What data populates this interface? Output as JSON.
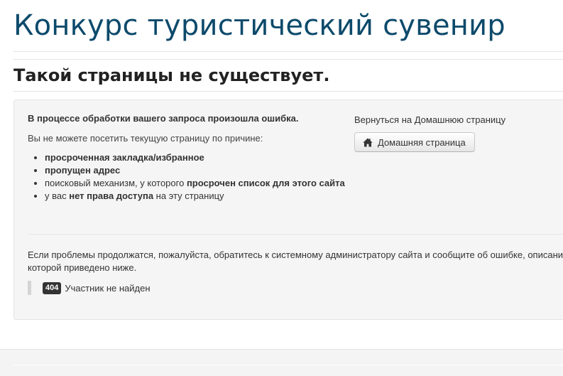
{
  "site": {
    "title": "Конкурс туристический сувенир"
  },
  "page": {
    "heading": "Такой страницы не существует."
  },
  "error": {
    "lead": "В процессе обработки вашего запроса произошла ошибка.",
    "reason_intro": "Вы не можете посетить текущую страницу по причине:",
    "reasons": [
      {
        "parts": [
          {
            "text": "просроченная закладка/избранное",
            "bold": true
          }
        ]
      },
      {
        "parts": [
          {
            "text": "пропущен адрес",
            "bold": true
          }
        ]
      },
      {
        "parts": [
          {
            "text": "поисковый механизм, у которого ",
            "bold": false
          },
          {
            "text": "просрочен список для этого сайта",
            "bold": true
          }
        ]
      },
      {
        "parts": [
          {
            "text": "у вас ",
            "bold": false
          },
          {
            "text": "нет права доступа",
            "bold": true
          },
          {
            "text": " на эту страницу",
            "bold": false
          }
        ]
      }
    ],
    "home_prompt": "Вернуться на Домашнюю страницу",
    "home_button_label": "Домашняя страница",
    "home_button_icon": "home-icon",
    "problem_text": "Если проблемы продолжатся, пожалуйста, обратитесь к системному администратору сайта и сообщите об ошибке, описание которой приведено ниже.",
    "code": "404",
    "message": "Участник не найден"
  },
  "colors": {
    "title": "#0d4a6b",
    "panel_bg": "#f5f5f5",
    "badge_bg": "#333333"
  }
}
